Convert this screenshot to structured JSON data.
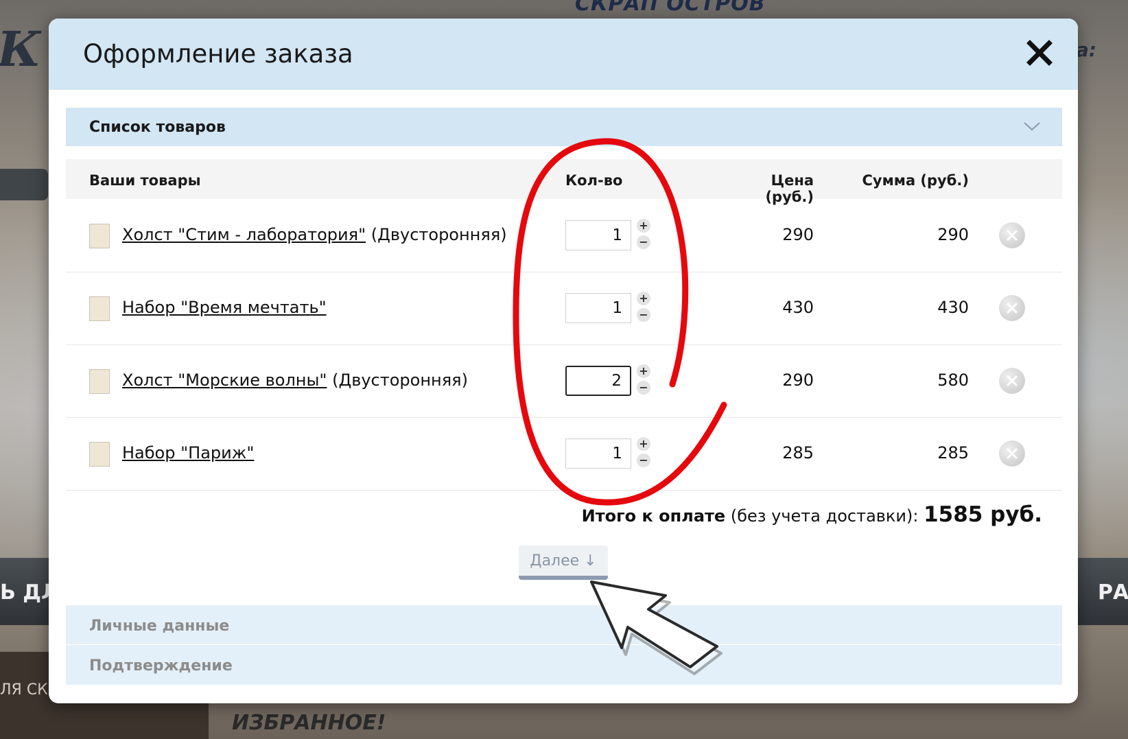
{
  "background": {
    "site_title": "СКРАП ОСТРОВ",
    "logo_fragment": "К",
    "header_right_fragment": "а:",
    "nav_left_fragment": "Ь ДЛ",
    "nav_right_fragment": "РА",
    "sidebar_fragment": "ЛЯ СК",
    "favorites": "ИЗБРАННОЕ!"
  },
  "modal": {
    "title": "Оформление заказа",
    "close_icon": "close-icon",
    "sections": {
      "products": "Список товаров",
      "personal": "Личные данные",
      "confirm": "Подтверждение"
    },
    "table": {
      "headers": {
        "name": "Ваши товары",
        "qty": "Кол-во",
        "price": "Цена (руб.)",
        "sum": "Сумма (руб.)"
      },
      "rows": [
        {
          "name": "Холст \"Стим - лаборатория\"",
          "variant": " (Двусторонняя)",
          "qty": "1",
          "price": "290",
          "sum": "290"
        },
        {
          "name": "Набор \"Время мечтать\"",
          "variant": "",
          "qty": "1",
          "price": "430",
          "sum": "430"
        },
        {
          "name": "Холст \"Морские волны\"",
          "variant": " (Двусторонняя)",
          "qty": "2",
          "price": "290",
          "sum": "580"
        },
        {
          "name": "Набор \"Париж\"",
          "variant": "",
          "qty": "1",
          "price": "285",
          "sum": "285"
        }
      ],
      "stepper": {
        "plus": "+",
        "minus": "−"
      }
    },
    "total": {
      "label": "Итого к оплате",
      "note": " (без учета доставки): ",
      "value": "1585 руб."
    },
    "next_button": "Далее ↓"
  },
  "colors": {
    "header_bg": "#d2e6f4",
    "annotation_red": "#e5090d"
  }
}
